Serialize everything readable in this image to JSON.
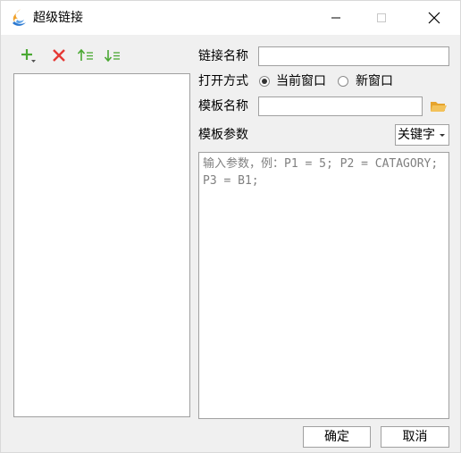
{
  "window": {
    "title": "超级链接"
  },
  "toolbar": {
    "add_icon": "plus-with-dropdown-icon",
    "delete_icon": "red-x-icon",
    "move_up_icon": "move-up-icon",
    "move_down_icon": "move-down-icon"
  },
  "form": {
    "link_name_label": "链接名称",
    "link_name_value": "",
    "open_mode_label": "打开方式",
    "open_options": [
      {
        "label": "当前窗口",
        "selected": true
      },
      {
        "label": "新窗口",
        "selected": false
      }
    ],
    "template_name_label": "模板名称",
    "template_name_value": "",
    "template_params_label": "模板参数",
    "param_type_selected": "关键字",
    "params_placeholder": "输入参数，例：P1 = 5; P2 = CATAGORY; P3 = B1;"
  },
  "buttons": {
    "ok": "确定",
    "cancel": "取消"
  },
  "colors": {
    "add_green": "#4aa832",
    "delete_red": "#e53935",
    "folder_yellow": "#f3b43a"
  }
}
